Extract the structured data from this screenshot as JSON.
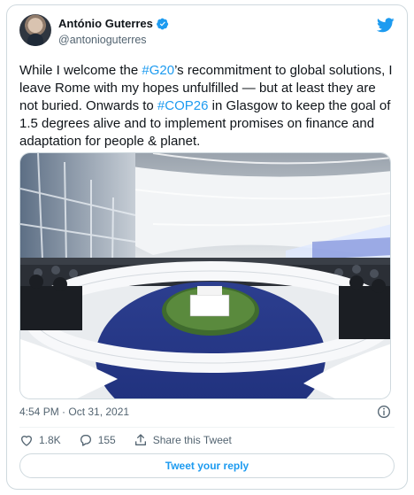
{
  "author": {
    "name": "António Guterres",
    "handle": "@antonioguterres"
  },
  "tweet": {
    "part1": "While I welcome the ",
    "tag1": "#G20",
    "part2": "’s recommitment to global solutions, I leave Rome with my hopes unfulfilled — but at least they are not buried. Onwards to ",
    "tag2": "#COP26",
    "part3": " in Glasgow to keep the goal of 1.5 degrees alive and to implement promises on finance and adaptation for people & planet."
  },
  "meta": {
    "timestamp": "4:54 PM · Oct 31, 2021"
  },
  "actions": {
    "likes": "1.8K",
    "replies": "155",
    "share_label": "Share this Tweet"
  },
  "reply_button": "Tweet your reply",
  "colors": {
    "accent": "#1d9bf0",
    "text": "#0f1419",
    "muted": "#536471",
    "border": "#cfd9de"
  }
}
